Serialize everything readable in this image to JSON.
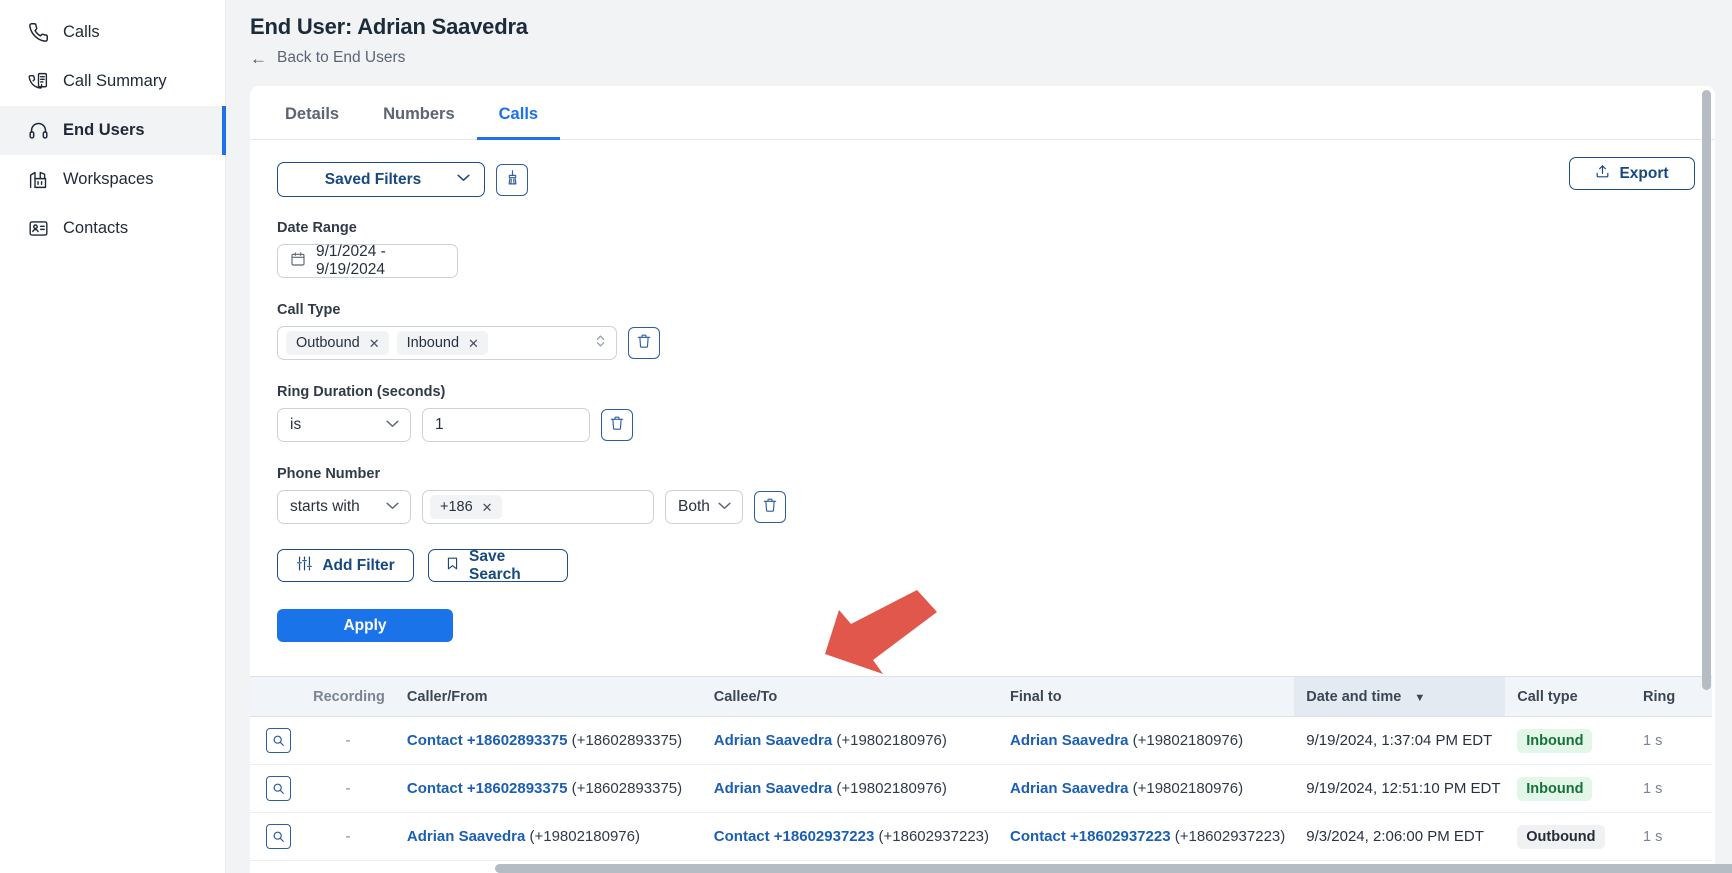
{
  "sidebar": {
    "items": [
      {
        "label": "Calls",
        "icon": "phone-icon",
        "active": false
      },
      {
        "label": "Call Summary",
        "icon": "call-summary-icon",
        "active": false
      },
      {
        "label": "End Users",
        "icon": "headset-icon",
        "active": true
      },
      {
        "label": "Workspaces",
        "icon": "building-icon",
        "active": false
      },
      {
        "label": "Contacts",
        "icon": "contact-card-icon",
        "active": false
      }
    ]
  },
  "header": {
    "title": "End User: Adrian Saavedra",
    "back_label": "Back to End Users"
  },
  "tabs": [
    {
      "label": "Details",
      "active": false
    },
    {
      "label": "Numbers",
      "active": false
    },
    {
      "label": "Calls",
      "active": true
    }
  ],
  "toolbar": {
    "saved_filters_label": "Saved Filters",
    "clear_filters_icon": "broom-icon",
    "export_label": "Export",
    "export_icon": "upload-icon"
  },
  "filters": {
    "date_range": {
      "label": "Date Range",
      "value": "9/1/2024 - 9/19/2024",
      "icon": "calendar-icon"
    },
    "call_type": {
      "label": "Call Type",
      "chips": [
        "Outbound",
        "Inbound"
      ],
      "delete_icon": "trash-icon"
    },
    "ring_duration": {
      "label": "Ring Duration (seconds)",
      "operator": "is",
      "value": "1",
      "delete_icon": "trash-icon"
    },
    "phone_number": {
      "label": "Phone Number",
      "operator": "starts with",
      "chips": [
        "+186"
      ],
      "direction": "Both",
      "delete_icon": "trash-icon"
    },
    "add_filter_label": "Add Filter",
    "add_filter_icon": "sliders-icon",
    "save_search_label": "Save Search",
    "save_search_icon": "bookmark-icon",
    "apply_label": "Apply"
  },
  "table": {
    "columns": [
      {
        "key": "mag",
        "label": ""
      },
      {
        "key": "recording",
        "label": "Recording"
      },
      {
        "key": "caller",
        "label": "Caller/From"
      },
      {
        "key": "callee",
        "label": "Callee/To"
      },
      {
        "key": "final",
        "label": "Final to"
      },
      {
        "key": "date",
        "label": "Date and time",
        "sorted": true,
        "sort_dir": "desc"
      },
      {
        "key": "type",
        "label": "Call type"
      },
      {
        "key": "ring",
        "label": "Ring"
      }
    ],
    "rows": [
      {
        "recording": "-",
        "caller_name": "Contact +18602893375",
        "caller_number": "(+18602893375)",
        "callee_name": "Adrian Saavedra",
        "callee_number": "(+19802180976)",
        "final_name": "Adrian Saavedra",
        "final_number": "(+19802180976)",
        "date": "9/19/2024, 1:37:04 PM EDT",
        "call_type": "Inbound",
        "ring": "1 s"
      },
      {
        "recording": "-",
        "caller_name": "Contact +18602893375",
        "caller_number": "(+18602893375)",
        "callee_name": "Adrian Saavedra",
        "callee_number": "(+19802180976)",
        "final_name": "Adrian Saavedra",
        "final_number": "(+19802180976)",
        "date": "9/19/2024, 12:51:10 PM EDT",
        "call_type": "Inbound",
        "ring": "1 s"
      },
      {
        "recording": "-",
        "caller_name": "Adrian Saavedra",
        "caller_number": "(+19802180976)",
        "callee_name": "Contact +18602937223",
        "callee_number": "(+18602937223)",
        "final_name": "Contact +18602937223",
        "final_number": "(+18602937223)",
        "date": "9/3/2024, 2:06:00 PM EDT",
        "call_type": "Outbound",
        "ring": "1 s"
      }
    ]
  },
  "colors": {
    "accent_blue": "#1a73e8",
    "link_blue": "#1a5fb4",
    "border_blue": "#1c4e8a",
    "inbound_green": "#17713a",
    "annotation_red": "#e2574c"
  }
}
